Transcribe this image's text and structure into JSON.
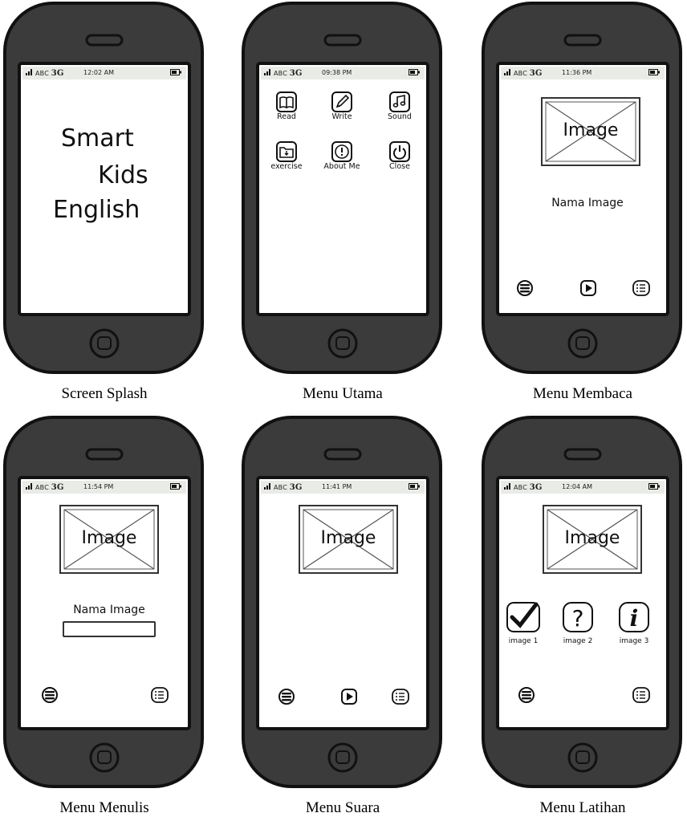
{
  "status_bar": {
    "carrier": "ABC",
    "network": "3G"
  },
  "phones": [
    {
      "caption": "Screen Splash",
      "time": "12:02 AM",
      "splash": [
        "Smart",
        "Kids",
        "English"
      ]
    },
    {
      "caption": "Menu Utama",
      "time": "09:38 PM",
      "menu": [
        "Read",
        "Write",
        "Sound",
        "exercise",
        "About Me",
        "Close"
      ]
    },
    {
      "caption": "Menu Membaca",
      "time": "11:36 PM",
      "image_text": "Image",
      "name_text": "Nama Image"
    },
    {
      "caption": "Menu Menulis",
      "time": "11:54 PM",
      "image_text": "Image",
      "name_text": "Nama Image"
    },
    {
      "caption": "Menu Suara",
      "time": "11:41 PM",
      "image_text": "Image"
    },
    {
      "caption": "Menu Latihan",
      "time": "12:04 AM",
      "image_text": "Image",
      "quiz": [
        "image 1",
        "image 2",
        "image 3"
      ]
    }
  ],
  "icons": {
    "signal": "signal-bars-icon",
    "battery": "battery-icon",
    "read": "book-icon",
    "write": "pencil-icon",
    "sound": "music-note-icon",
    "exercise": "folder-icon",
    "about": "exclamation-icon",
    "close": "power-icon",
    "menu": "hamburger-menu-icon",
    "play": "play-icon",
    "list": "list-icon",
    "check": "checkmark-icon",
    "question": "question-mark-icon",
    "info": "info-icon"
  },
  "colors": {
    "phone_body": "#3b3b3b",
    "phone_outline": "#111111",
    "status_bar": "#e9ebe6",
    "screen": "#ffffff"
  }
}
